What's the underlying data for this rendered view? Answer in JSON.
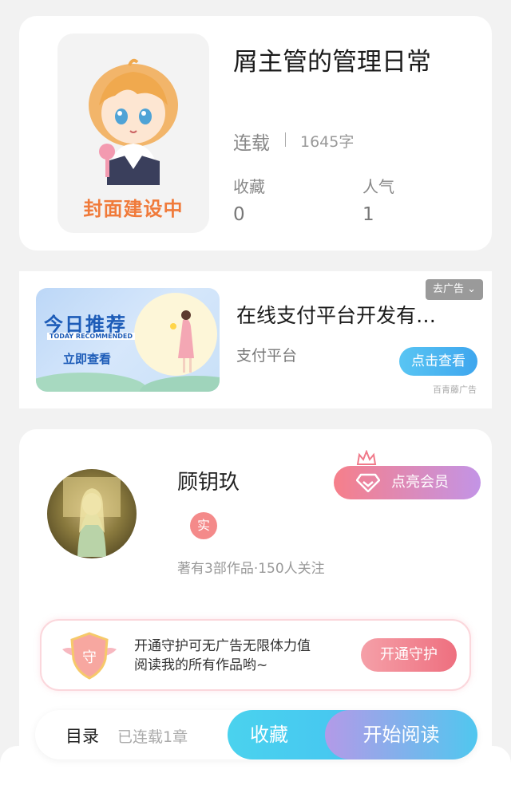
{
  "book": {
    "title": "屑主管的管理日常",
    "cover_text": "封面建设中",
    "status": "连载",
    "word_count": "1645字",
    "stats": [
      {
        "label": "收藏",
        "value": "0"
      },
      {
        "label": "人气",
        "value": "1"
      }
    ]
  },
  "ad": {
    "banner_title": "今日推荐",
    "banner_subtitle": "TODAY RECOMMENDED",
    "banner_cta": "立即查看",
    "title": "在线支付平台开发有…",
    "subtitle": "支付平台",
    "button": "点击查看",
    "close_label": "去广告 ⌄",
    "source": "百青藤广告"
  },
  "author": {
    "name": "顾钥玖",
    "verified_label": "实",
    "meta": "著有3部作品·150人关注",
    "vip_button": "点亮会员"
  },
  "guard": {
    "badge": "守",
    "line1": "开通守护可无广告无限体力值",
    "line2": "阅读我的所有作品哟~",
    "button": "开通守护"
  },
  "bottom_bar": {
    "toc": "目录",
    "chapters": "已连载1章",
    "favorite": "收藏",
    "start_reading": "开始阅读"
  }
}
